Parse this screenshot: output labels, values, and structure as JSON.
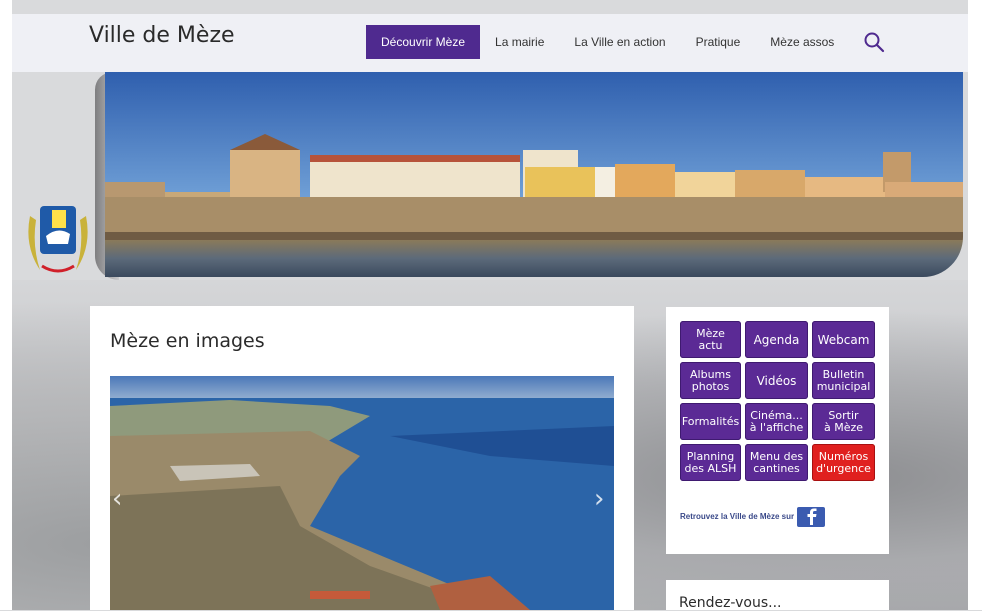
{
  "header": {
    "site_title": "Ville de Mèze",
    "nav": [
      "Découvrir Mèze",
      "La mairie",
      "La Ville en action",
      "Pratique",
      "Mèze assos"
    ],
    "active_nav": "Découvrir Mèze",
    "search_icon": "search-icon"
  },
  "main": {
    "title": "Mèze en images",
    "prev_arrow": "‹",
    "next_arrow": "›"
  },
  "sidebar": {
    "buttons": [
      {
        "label": "Mèze\nactu",
        "color": "#5b2a95"
      },
      {
        "label": "Agenda",
        "color": "#5b2a95"
      },
      {
        "label": "Webcam",
        "color": "#5b2a95"
      },
      {
        "label": "Albums\nphotos",
        "color": "#5b2a95"
      },
      {
        "label": "Vidéos",
        "color": "#5b2a95"
      },
      {
        "label": "Bulletin\nmunicipal",
        "color": "#5b2a95"
      },
      {
        "label": "Formalités",
        "color": "#5b2a95"
      },
      {
        "label": "Cinéma...\nà l'affiche",
        "color": "#5b2a95"
      },
      {
        "label": "Sortir\nà Mèze",
        "color": "#5b2a95"
      },
      {
        "label": "Planning\ndes ALSH",
        "color": "#5b2a95"
      },
      {
        "label": "Menu des\ncantines",
        "color": "#5b2a95"
      },
      {
        "label": "Numéros\nd'urgence",
        "color": "#e0201f"
      }
    ],
    "facebook_text": "Retrouvez la Ville de Mèze sur",
    "facebook_icon": "facebook-icon"
  },
  "rendezvous": {
    "title": "Rendez-vous..."
  },
  "colors": {
    "accent": "#4f2a8f",
    "button": "#5b2a95",
    "urgent": "#e0201f"
  }
}
